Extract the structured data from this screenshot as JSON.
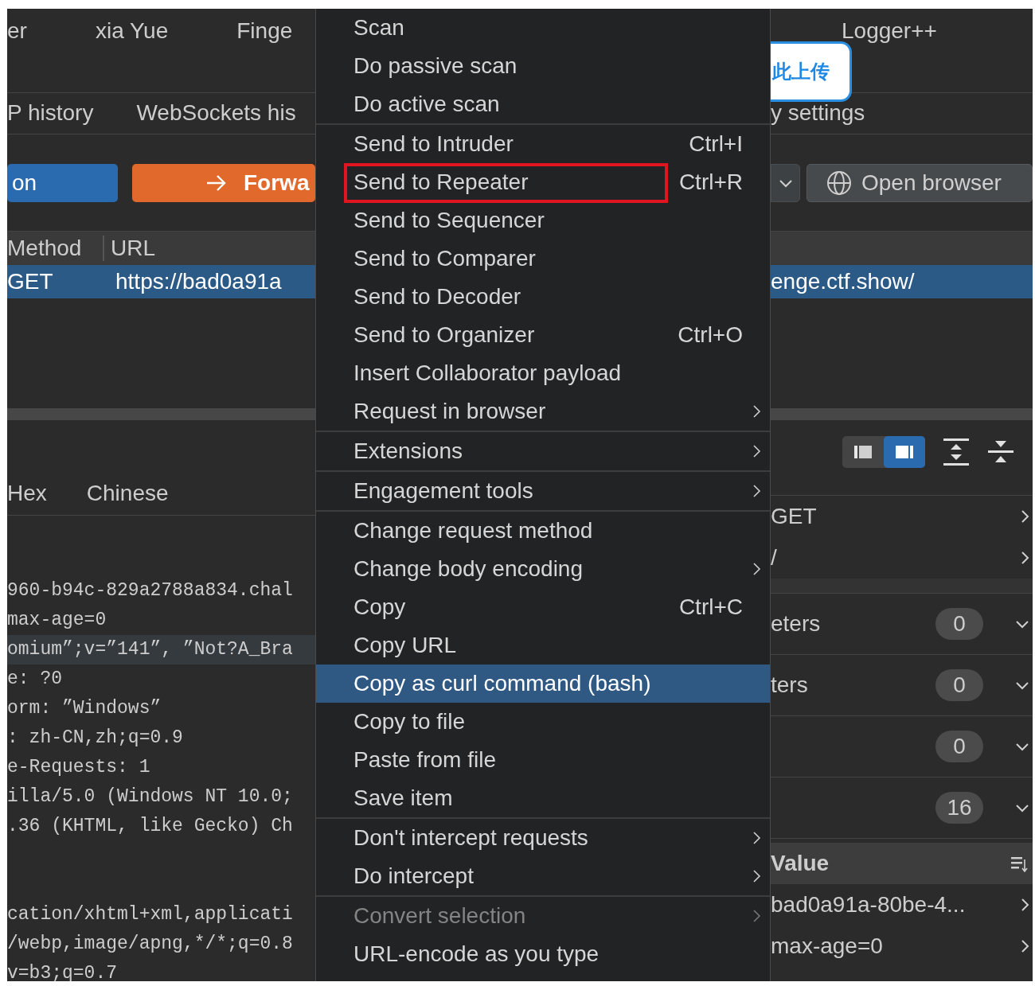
{
  "left_pane": {
    "tool_tabs": [
      "er",
      "xia Yue",
      "Finge"
    ],
    "proxy_tabs": [
      "P history",
      "WebSockets his"
    ],
    "buttons": [
      {
        "label": "on",
        "kind": "toggle"
      },
      {
        "label": "Forwa",
        "kind": "forward"
      }
    ],
    "table": {
      "columns": [
        "Method",
        "URL"
      ],
      "rows": [
        {
          "cells": [
            "GET",
            "https://bad0a91a"
          ],
          "selected": true
        }
      ]
    },
    "editor_tabs": [
      "Hex",
      "Chinese"
    ],
    "line_groups": [
      [
        {
          "text": "960-b94c-829a2788a834.chal",
          "highlighted": false
        },
        {
          "text": "max-age=0",
          "highlighted": false
        },
        {
          "text": "omium”;v=”141”, ”Not?A_Bra",
          "highlighted": true
        },
        {
          "text": "e: ?0",
          "highlighted": false
        },
        {
          "text": "orm: ”Windows”",
          "highlighted": false
        },
        {
          "text": ": zh-CN,zh;q=0.9",
          "highlighted": false
        },
        {
          "text": "e-Requests: 1",
          "highlighted": false
        },
        {
          "text": "illa/5.0 (Windows NT 10.0;",
          "highlighted": false
        },
        {
          "text": ".36 (KHTML, like Gecko) Ch",
          "highlighted": false
        }
      ],
      [
        {
          "text": "cation/xhtml+xml,applicati",
          "highlighted": false
        },
        {
          "text": "/webp,image/apng,*/*;q=0.8",
          "highlighted": false
        },
        {
          "text": "v=b3;q=0.7",
          "highlighted": false
        }
      ]
    ]
  },
  "context_menu": {
    "groups": [
      {
        "items": [
          {
            "label": "Scan",
            "submenu": false,
            "selected": false,
            "disabled": false,
            "annotated": false
          },
          {
            "label": "Do passive scan",
            "submenu": false,
            "selected": false,
            "disabled": false,
            "annotated": false
          },
          {
            "label": "Do active scan",
            "submenu": false,
            "selected": false,
            "disabled": false,
            "annotated": false
          }
        ]
      },
      {
        "items": [
          {
            "label": "Send to Intruder",
            "shortcut": "Ctrl+I",
            "submenu": false,
            "selected": false,
            "disabled": false,
            "annotated": false
          },
          {
            "label": "Send to Repeater",
            "shortcut": "Ctrl+R",
            "submenu": false,
            "selected": false,
            "disabled": false,
            "annotated": true
          },
          {
            "label": "Send to Sequencer",
            "submenu": false,
            "selected": false,
            "disabled": false,
            "annotated": false
          },
          {
            "label": "Send to Comparer",
            "submenu": false,
            "selected": false,
            "disabled": false,
            "annotated": false
          },
          {
            "label": "Send to Decoder",
            "submenu": false,
            "selected": false,
            "disabled": false,
            "annotated": false
          },
          {
            "label": "Send to Organizer",
            "shortcut": "Ctrl+O",
            "submenu": false,
            "selected": false,
            "disabled": false,
            "annotated": false
          },
          {
            "label": "Insert Collaborator payload",
            "submenu": false,
            "selected": false,
            "disabled": false,
            "annotated": false
          },
          {
            "label": "Request in browser",
            "submenu": true,
            "selected": false,
            "disabled": false,
            "annotated": false
          }
        ]
      },
      {
        "items": [
          {
            "label": "Extensions",
            "submenu": true,
            "selected": false,
            "disabled": false,
            "annotated": false
          }
        ]
      },
      {
        "items": [
          {
            "label": "Engagement tools",
            "submenu": true,
            "selected": false,
            "disabled": false,
            "annotated": false
          }
        ]
      },
      {
        "items": [
          {
            "label": "Change request method",
            "submenu": false,
            "selected": false,
            "disabled": false,
            "annotated": false
          },
          {
            "label": "Change body encoding",
            "submenu": true,
            "selected": false,
            "disabled": false,
            "annotated": false
          },
          {
            "label": "Copy",
            "shortcut": "Ctrl+C",
            "submenu": false,
            "selected": false,
            "disabled": false,
            "annotated": false
          },
          {
            "label": "Copy URL",
            "submenu": false,
            "selected": false,
            "disabled": false,
            "annotated": false
          },
          {
            "label": "Copy as curl command (bash)",
            "submenu": false,
            "selected": true,
            "disabled": false,
            "annotated": false
          },
          {
            "label": "Copy to file",
            "submenu": false,
            "selected": false,
            "disabled": false,
            "annotated": false
          },
          {
            "label": "Paste from file",
            "submenu": false,
            "selected": false,
            "disabled": false,
            "annotated": false
          },
          {
            "label": "Save item",
            "submenu": false,
            "selected": false,
            "disabled": false,
            "annotated": false
          }
        ]
      },
      {
        "items": [
          {
            "label": "Don't intercept requests",
            "submenu": true,
            "selected": false,
            "disabled": false,
            "annotated": false
          },
          {
            "label": "Do intercept",
            "submenu": true,
            "selected": false,
            "disabled": false,
            "annotated": false
          }
        ]
      },
      {
        "items": [
          {
            "label": "Convert selection",
            "submenu": true,
            "selected": false,
            "disabled": true,
            "annotated": false
          },
          {
            "label": "URL-encode as you type",
            "submenu": false,
            "selected": false,
            "disabled": false,
            "annotated": false
          }
        ]
      }
    ]
  },
  "right_pane": {
    "tool_tabs": [
      "Logger++"
    ],
    "upload_badge": "此上传",
    "proxy_tabs": [
      "y settings"
    ],
    "open_browser_button": "Open browser",
    "table_rows": [
      {
        "cells": [
          "enge.ctf.show/"
        ],
        "selected": true
      }
    ],
    "layout_toggle": [
      {
        "selected": false
      },
      {
        "selected": true
      }
    ],
    "request_attributes": [
      {
        "value": "GET"
      },
      {
        "value": "/"
      }
    ],
    "sections": [
      {
        "label": "eters",
        "count": "0"
      },
      {
        "label": "ters",
        "count": "0"
      },
      {
        "count": "0"
      },
      {
        "count": "16"
      }
    ],
    "headers_table": {
      "columns": [
        "Value"
      ],
      "rows": [
        "bad0a91a-80be-4...",
        "max-age=0"
      ]
    }
  }
}
